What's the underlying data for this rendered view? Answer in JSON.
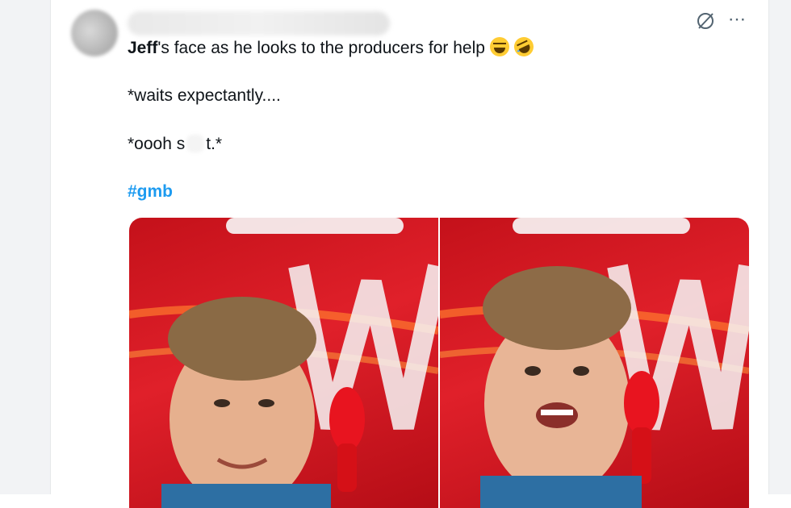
{
  "tweet": {
    "author_name_hidden": true,
    "text_line1_bold": "Jeff",
    "text_line1_rest": "'s face as he looks to the producers for help",
    "emoji1": "grinning-squinting-face",
    "emoji2": "rolling-on-floor-laughing",
    "text_line2": "*waits expectantly....",
    "text_line3_start": "*oooh s",
    "text_line3_end": "t.*",
    "hashtag": "#gmb",
    "images": [
      {
        "label": "jeff-photo-1",
        "description_icon": "photo-icon"
      },
      {
        "label": "jeff-photo-2",
        "description_icon": "photo-icon"
      }
    ]
  },
  "icons": {
    "hide": "eye-slash-icon",
    "more": "more-icon"
  },
  "colors": {
    "link": "#1d9bf0",
    "text": "#0f1419",
    "secondary": "#536471",
    "photo_bg": "#d8161e"
  }
}
